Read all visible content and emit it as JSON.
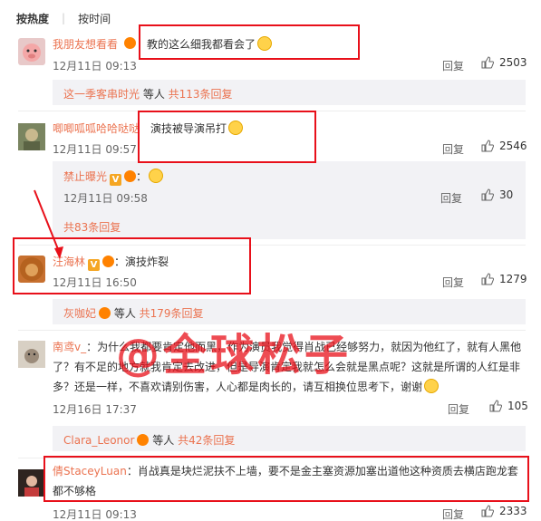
{
  "sort": {
    "hot": "按热度",
    "sep": "|",
    "time": "按时间"
  },
  "comments": [
    {
      "user": "我朋友想看看",
      "text": "教的这么细我都看会了",
      "time": "12月11日 09:13",
      "reply": "回复",
      "likes": "2503",
      "sub_summary": {
        "user": "这一季客串时光",
        "mid": " 等人 ",
        "count": "共113条回复"
      }
    },
    {
      "user": "唧唧呱呱哈哈哒哒",
      "text": "演技被导演吊打",
      "time": "12月11日 09:57",
      "reply": "回复",
      "likes": "2546",
      "sub_reply": {
        "user": "禁止曝光",
        "sep": "：",
        "time": "12月11日 09:58",
        "reply": "回复",
        "likes": "30"
      },
      "sub_summary": {
        "count": "共83条回复"
      }
    },
    {
      "user": "汪海林",
      "sep": "：",
      "text": "演技炸裂",
      "time": "12月11日 16:50",
      "reply": "回复",
      "likes": "1279",
      "sub_summary": {
        "user": "灰咖妃",
        "mid": " 等人 ",
        "count": "共179条回复"
      }
    },
    {
      "user": "南鸢v_",
      "sep": "：",
      "text": "为什么我都要肯定他而黑，作为演员我觉得肖战已经够努力，就因为他红了，就有人黑他了？有不足的地方就我肯定去改进，但是导演肯定我就怎么会就是黑点呢？这就是所谓的人红是非多？还是一样，不喜欢请别伤害，人心都是肉长的，请互相换位思考下，谢谢",
      "time": "12月16日 17:37",
      "reply": "回复",
      "likes": "105",
      "sub_summary": {
        "user": "Clara_Leonor",
        "mid": " 等人 ",
        "count": "共42条回复"
      }
    },
    {
      "user": "倩StaceyLuan",
      "sep": "：",
      "text": "肖战真是块烂泥扶不上墙，要不是金主塞资源加塞出道他这种资质去横店跑龙套都不够格",
      "time": "12月11日 09:13",
      "reply": "回复",
      "likes": "2333"
    }
  ],
  "watermark": "@全球松子",
  "colors": {
    "accent": "#eb7350",
    "annotation": "#e8101a",
    "subbox": "#f2f2f5"
  }
}
